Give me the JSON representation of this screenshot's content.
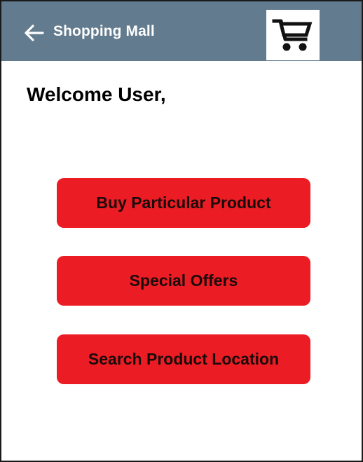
{
  "header": {
    "title": "Shopping Mall",
    "back_icon": "arrow-left-icon",
    "cart_icon": "shopping-cart-icon",
    "background_color": "#627b8e"
  },
  "main": {
    "greeting": "Welcome User,",
    "buttons": [
      {
        "label": "Buy Particular Product"
      },
      {
        "label": "Special Offers"
      },
      {
        "label": "Search Product Location"
      }
    ],
    "button_color": "#ec1c24"
  }
}
